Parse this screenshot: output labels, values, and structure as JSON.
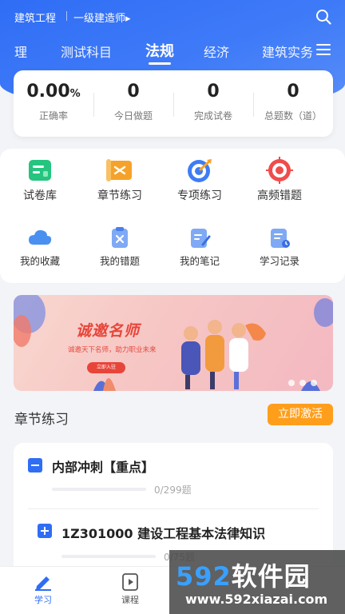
{
  "topbar": {
    "exam": "建筑工程",
    "level": "一级建造师▸"
  },
  "tabs": [
    {
      "label": "理",
      "active": false
    },
    {
      "label": "测试科目",
      "active": false
    },
    {
      "label": "法规",
      "active": true
    },
    {
      "label": "经济",
      "active": false
    },
    {
      "label": "建筑实务",
      "active": false
    }
  ],
  "stats": [
    {
      "value": "0.00",
      "unit": "%",
      "label": "正确率"
    },
    {
      "value": "0",
      "unit": "",
      "label": "今日做题"
    },
    {
      "value": "0",
      "unit": "",
      "label": "完成试卷"
    },
    {
      "value": "0",
      "unit": "",
      "label": "总题数（道）"
    }
  ],
  "features": [
    {
      "label": "试卷库",
      "icon": "paper-bank-icon"
    },
    {
      "label": "章节练习",
      "icon": "chapter-scroll-icon"
    },
    {
      "label": "专项练习",
      "icon": "target-icon"
    },
    {
      "label": "高频错题",
      "icon": "high-freq-target-icon"
    },
    {
      "label": "我的收藏",
      "icon": "cloud-favorite-icon"
    },
    {
      "label": "我的错题",
      "icon": "wrong-clipboard-icon"
    },
    {
      "label": "我的笔记",
      "icon": "note-pen-icon"
    },
    {
      "label": "学习记录",
      "icon": "record-clock-icon"
    }
  ],
  "banner": {
    "title": "诚邀名师",
    "subtitle": "诚邀天下名师，助力职业未来",
    "button": "立即入驻"
  },
  "section": {
    "title": "章节练习",
    "activate_label": "立即激活"
  },
  "chapters": [
    {
      "title": "内部冲刺【重点】",
      "progress": "0/299题",
      "expanded": true
    },
    {
      "title": "1Z301000 建设工程基本法律知识",
      "progress": "0/75题",
      "expanded": false
    }
  ],
  "bottom_nav": [
    {
      "label": "学习",
      "icon": "pen-study-icon",
      "active": true
    },
    {
      "label": "课程",
      "icon": "play-course-icon",
      "active": false
    }
  ],
  "watermark": {
    "brand_num": "592",
    "brand_text": "软件园",
    "url": "www.592xiazai.com"
  },
  "colors": {
    "primary": "#2f6df5",
    "accent": "#ff9e1b",
    "banner_red": "#e8453a"
  }
}
